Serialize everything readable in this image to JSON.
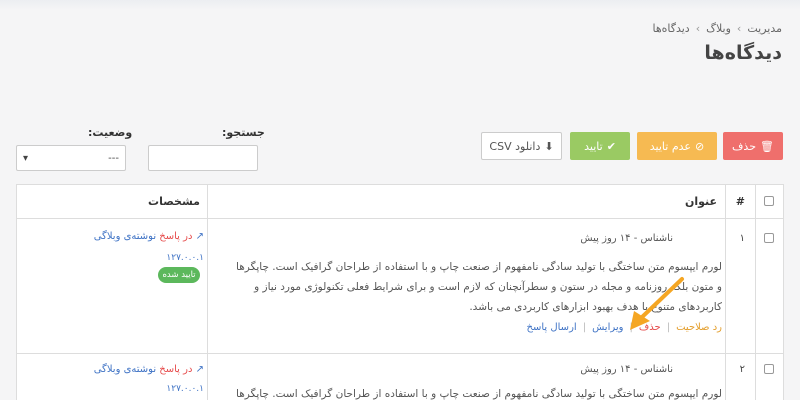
{
  "breadcrumb": {
    "items": [
      "مدیریت",
      "وبلاگ",
      "دیدگاه‌ها"
    ],
    "sep": "›"
  },
  "page": {
    "title": "دیدگاه‌ها"
  },
  "toolbar": {
    "delete_label": "حذف",
    "reject_label": "عدم تایید",
    "approve_label": "تایید",
    "csv_label": "دانلود CSV",
    "delete_icon": "trash-icon",
    "reject_icon": "ban-icon",
    "approve_icon": "check-icon",
    "csv_icon": "download-icon"
  },
  "filters": {
    "search_label": "جستجو:",
    "search_value": "",
    "status_label": "وضعیت:",
    "status_value": "---"
  },
  "table": {
    "headers": {
      "num": "#",
      "title": "عنوان",
      "spec": "مشخصات"
    },
    "rows": [
      {
        "num": "۱",
        "meta": "ناشناس - ۱۴ روز پیش",
        "body": "لورم ایپسوم متن ساختگی با تولید سادگی نامفهوم از صنعت چاپ و با استفاده از طراحان گرافیک است. چاپگرها و متون بلکه روزنامه و مجله در ستون و سطرآنچنان که لازم است و برای شرایط فعلی تکنولوژی مورد نیاز و کاربردهای متنوع با هدف بهبود ابزارهای کاربردی می باشد.",
        "actions": {
          "unapprove": "رد صلاحیت",
          "delete": "حذف",
          "edit": "ویرایش",
          "reply": "ارسال پاسخ",
          "sep": "|"
        },
        "spec": {
          "reply_prefix": "در پاسخ",
          "reply_target": "نوشته‌ی وبلاگی",
          "ip": "۱۲۷.۰.۰.۱",
          "badge": "تایید شده"
        }
      },
      {
        "num": "۲",
        "meta": "ناشناس - ۱۴ روز پیش",
        "body": "لورم ایپسوم متن ساختگی با تولید سادگی نامفهوم از صنعت چاپ و با استفاده از طراحان گرافیک است. چاپگرها و",
        "spec": {
          "reply_prefix": "در پاسخ",
          "reply_target": "نوشته‌ی وبلاگی",
          "ip": "۱۲۷.۰.۰.۱"
        }
      }
    ]
  },
  "colors": {
    "delete": "#ef6f6c",
    "reject": "#f6ba52",
    "approve": "#8bc34a",
    "badge": "#5cb85c",
    "link": "#3f73c5",
    "arrow": "#f5a623"
  }
}
